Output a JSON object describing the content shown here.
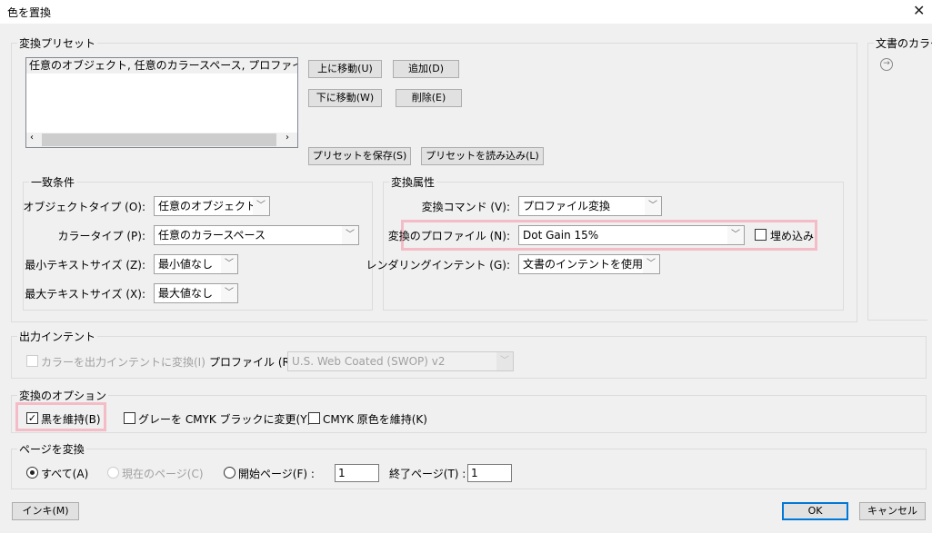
{
  "window": {
    "title": "色を置換",
    "close_icon": "close-icon"
  },
  "presets": {
    "legend": "変換プリセット",
    "list_items": [
      "任意のオブジェクト, 任意のカラースペース, プロファイル変換"
    ],
    "move_up": "上に移動(U)",
    "add": "追加(D)",
    "move_down": "下に移動(W)",
    "delete": "削除(E)",
    "save": "プリセットを保存(S)",
    "load": "プリセットを読み込み(L)"
  },
  "match": {
    "legend": "一致条件",
    "object_type": {
      "label": "オブジェクトタイプ (O):",
      "value": "任意のオブジェクト"
    },
    "color_type": {
      "label": "カラータイプ (P):",
      "value": "任意のカラースペース"
    },
    "min_text": {
      "label": "最小テキストサイズ (Z):",
      "value": "最小値なし"
    },
    "max_text": {
      "label": "最大テキストサイズ (X):",
      "value": "最大値なし"
    }
  },
  "attrs": {
    "legend": "変換属性",
    "command": {
      "label": "変換コマンド (V):",
      "value": "プロファイル変換"
    },
    "profile": {
      "label": "変換のプロファイル (N):",
      "value": "Dot Gain 15%"
    },
    "embed": {
      "label": "埋め込み",
      "checked": false
    },
    "intent": {
      "label": "レンダリングインテント (G):",
      "value": "文書のインテントを使用"
    }
  },
  "doc_colors": {
    "legend": "文書のカラー",
    "icon": "arrow-right-circle-icon"
  },
  "output": {
    "legend": "出力インテント",
    "convert": {
      "label": "カラーを出力インテントに変換(I)",
      "checked": false,
      "disabled": true
    },
    "profile": {
      "label": "プロファイル (R):",
      "value": "U.S. Web Coated (SWOP) v2"
    }
  },
  "options": {
    "legend": "変換のオプション",
    "preserve_black": {
      "label": "黒を維持(B)",
      "checked": true
    },
    "gray_to_black": {
      "label": "グレーを CMYK ブラックに変更(Y)",
      "checked": false
    },
    "preserve_primaries": {
      "label": "CMYK 原色を維持(K)",
      "checked": false
    }
  },
  "pages": {
    "legend": "ページを変換",
    "all": "すべて(A)",
    "current": "現在のページ(C)",
    "from": "開始ページ(F) :",
    "from_value": "1",
    "to": "終了ページ(T) :",
    "to_value": "1",
    "selected": "all"
  },
  "footer": {
    "ink": "インキ(M)",
    "ok": "OK",
    "cancel": "キャンセル"
  },
  "colors": {
    "highlight": "#f4bcc6",
    "default_button": "#0078d7"
  }
}
